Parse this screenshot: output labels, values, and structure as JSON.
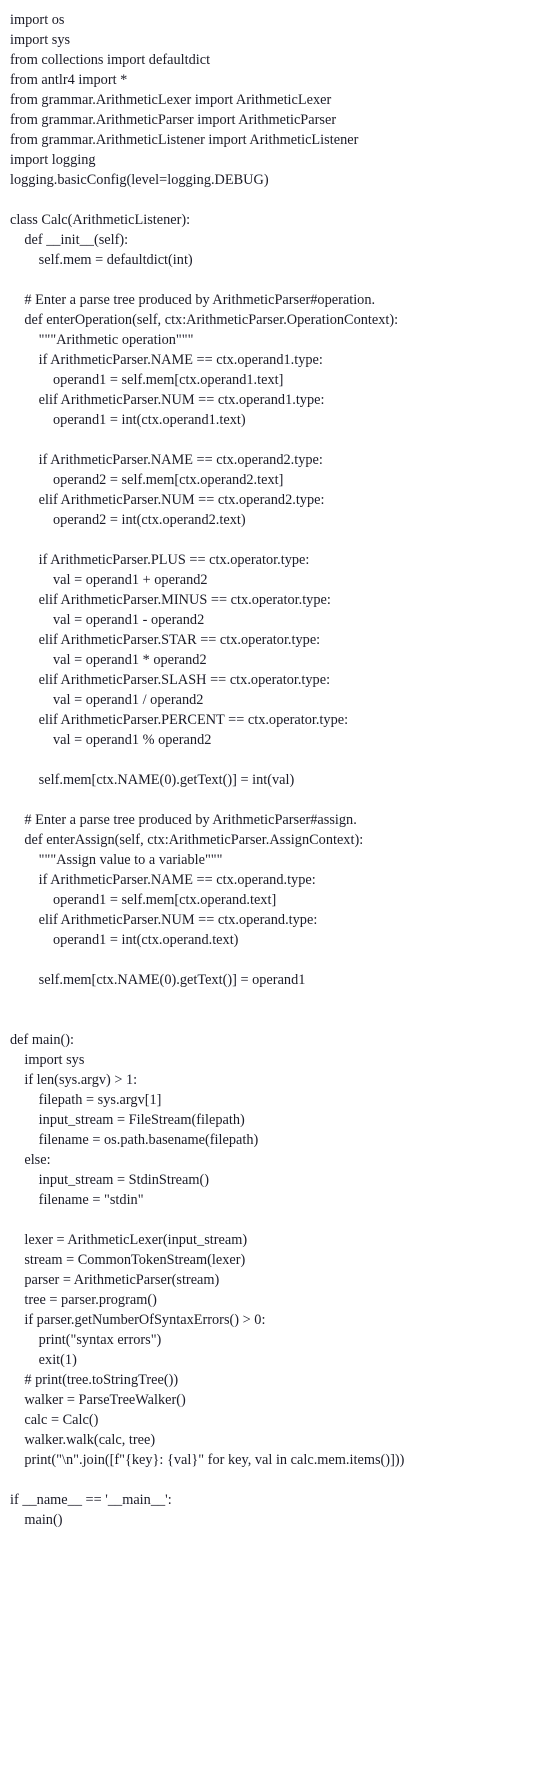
{
  "document": {
    "kind": "source-code-listing",
    "language": "Python",
    "background_color": "#ffffff",
    "text_color": "#1a1a26",
    "indent_unit": "    ",
    "lines": [
      "import os",
      "import sys",
      "from collections import defaultdict",
      "from antlr4 import *",
      "from grammar.ArithmeticLexer import ArithmeticLexer",
      "from grammar.ArithmeticParser import ArithmeticParser",
      "from grammar.ArithmeticListener import ArithmeticListener",
      "import logging",
      "logging.basicConfig(level=logging.DEBUG)",
      "",
      "class Calc(ArithmeticListener):",
      "    def __init__(self):",
      "        self.mem = defaultdict(int)",
      "",
      "    # Enter a parse tree produced by ArithmeticParser#operation.",
      "    def enterOperation(self, ctx:ArithmeticParser.OperationContext):",
      "        \"\"\"Arithmetic operation\"\"\"",
      "        if ArithmeticParser.NAME == ctx.operand1.type:",
      "            operand1 = self.mem[ctx.operand1.text]",
      "        elif ArithmeticParser.NUM == ctx.operand1.type:",
      "            operand1 = int(ctx.operand1.text)",
      "",
      "        if ArithmeticParser.NAME == ctx.operand2.type:",
      "            operand2 = self.mem[ctx.operand2.text]",
      "        elif ArithmeticParser.NUM == ctx.operand2.type:",
      "            operand2 = int(ctx.operand2.text)",
      "",
      "        if ArithmeticParser.PLUS == ctx.operator.type:",
      "            val = operand1 + operand2",
      "        elif ArithmeticParser.MINUS == ctx.operator.type:",
      "            val = operand1 - operand2",
      "        elif ArithmeticParser.STAR == ctx.operator.type:",
      "            val = operand1 * operand2",
      "        elif ArithmeticParser.SLASH == ctx.operator.type:",
      "            val = operand1 / operand2",
      "        elif ArithmeticParser.PERCENT == ctx.operator.type:",
      "            val = operand1 % operand2",
      "",
      "        self.mem[ctx.NAME(0).getText()] = int(val)",
      "",
      "    # Enter a parse tree produced by ArithmeticParser#assign.",
      "    def enterAssign(self, ctx:ArithmeticParser.AssignContext):",
      "        \"\"\"Assign value to a variable\"\"\"",
      "        if ArithmeticParser.NAME == ctx.operand.type:",
      "            operand1 = self.mem[ctx.operand.text]",
      "        elif ArithmeticParser.NUM == ctx.operand.type:",
      "            operand1 = int(ctx.operand.text)",
      "",
      "        self.mem[ctx.NAME(0).getText()] = operand1",
      "",
      "",
      "def main():",
      "    import sys",
      "    if len(sys.argv) > 1:",
      "        filepath = sys.argv[1]",
      "        input_stream = FileStream(filepath)",
      "        filename = os.path.basename(filepath)",
      "    else:",
      "        input_stream = StdinStream()",
      "        filename = \"stdin\"",
      "",
      "    lexer = ArithmeticLexer(input_stream)",
      "    stream = CommonTokenStream(lexer)",
      "    parser = ArithmeticParser(stream)",
      "    tree = parser.program()",
      "    if parser.getNumberOfSyntaxErrors() > 0:",
      "        print(\"syntax errors\")",
      "        exit(1)",
      "    # print(tree.toStringTree())",
      "    walker = ParseTreeWalker()",
      "    calc = Calc()",
      "    walker.walk(calc, tree)",
      "    print(\"\\n\".join([f\"{key}: {val}\" for key, val in calc.mem.items()]))",
      "",
      "if __name__ == '__main__':",
      "    main()"
    ]
  }
}
